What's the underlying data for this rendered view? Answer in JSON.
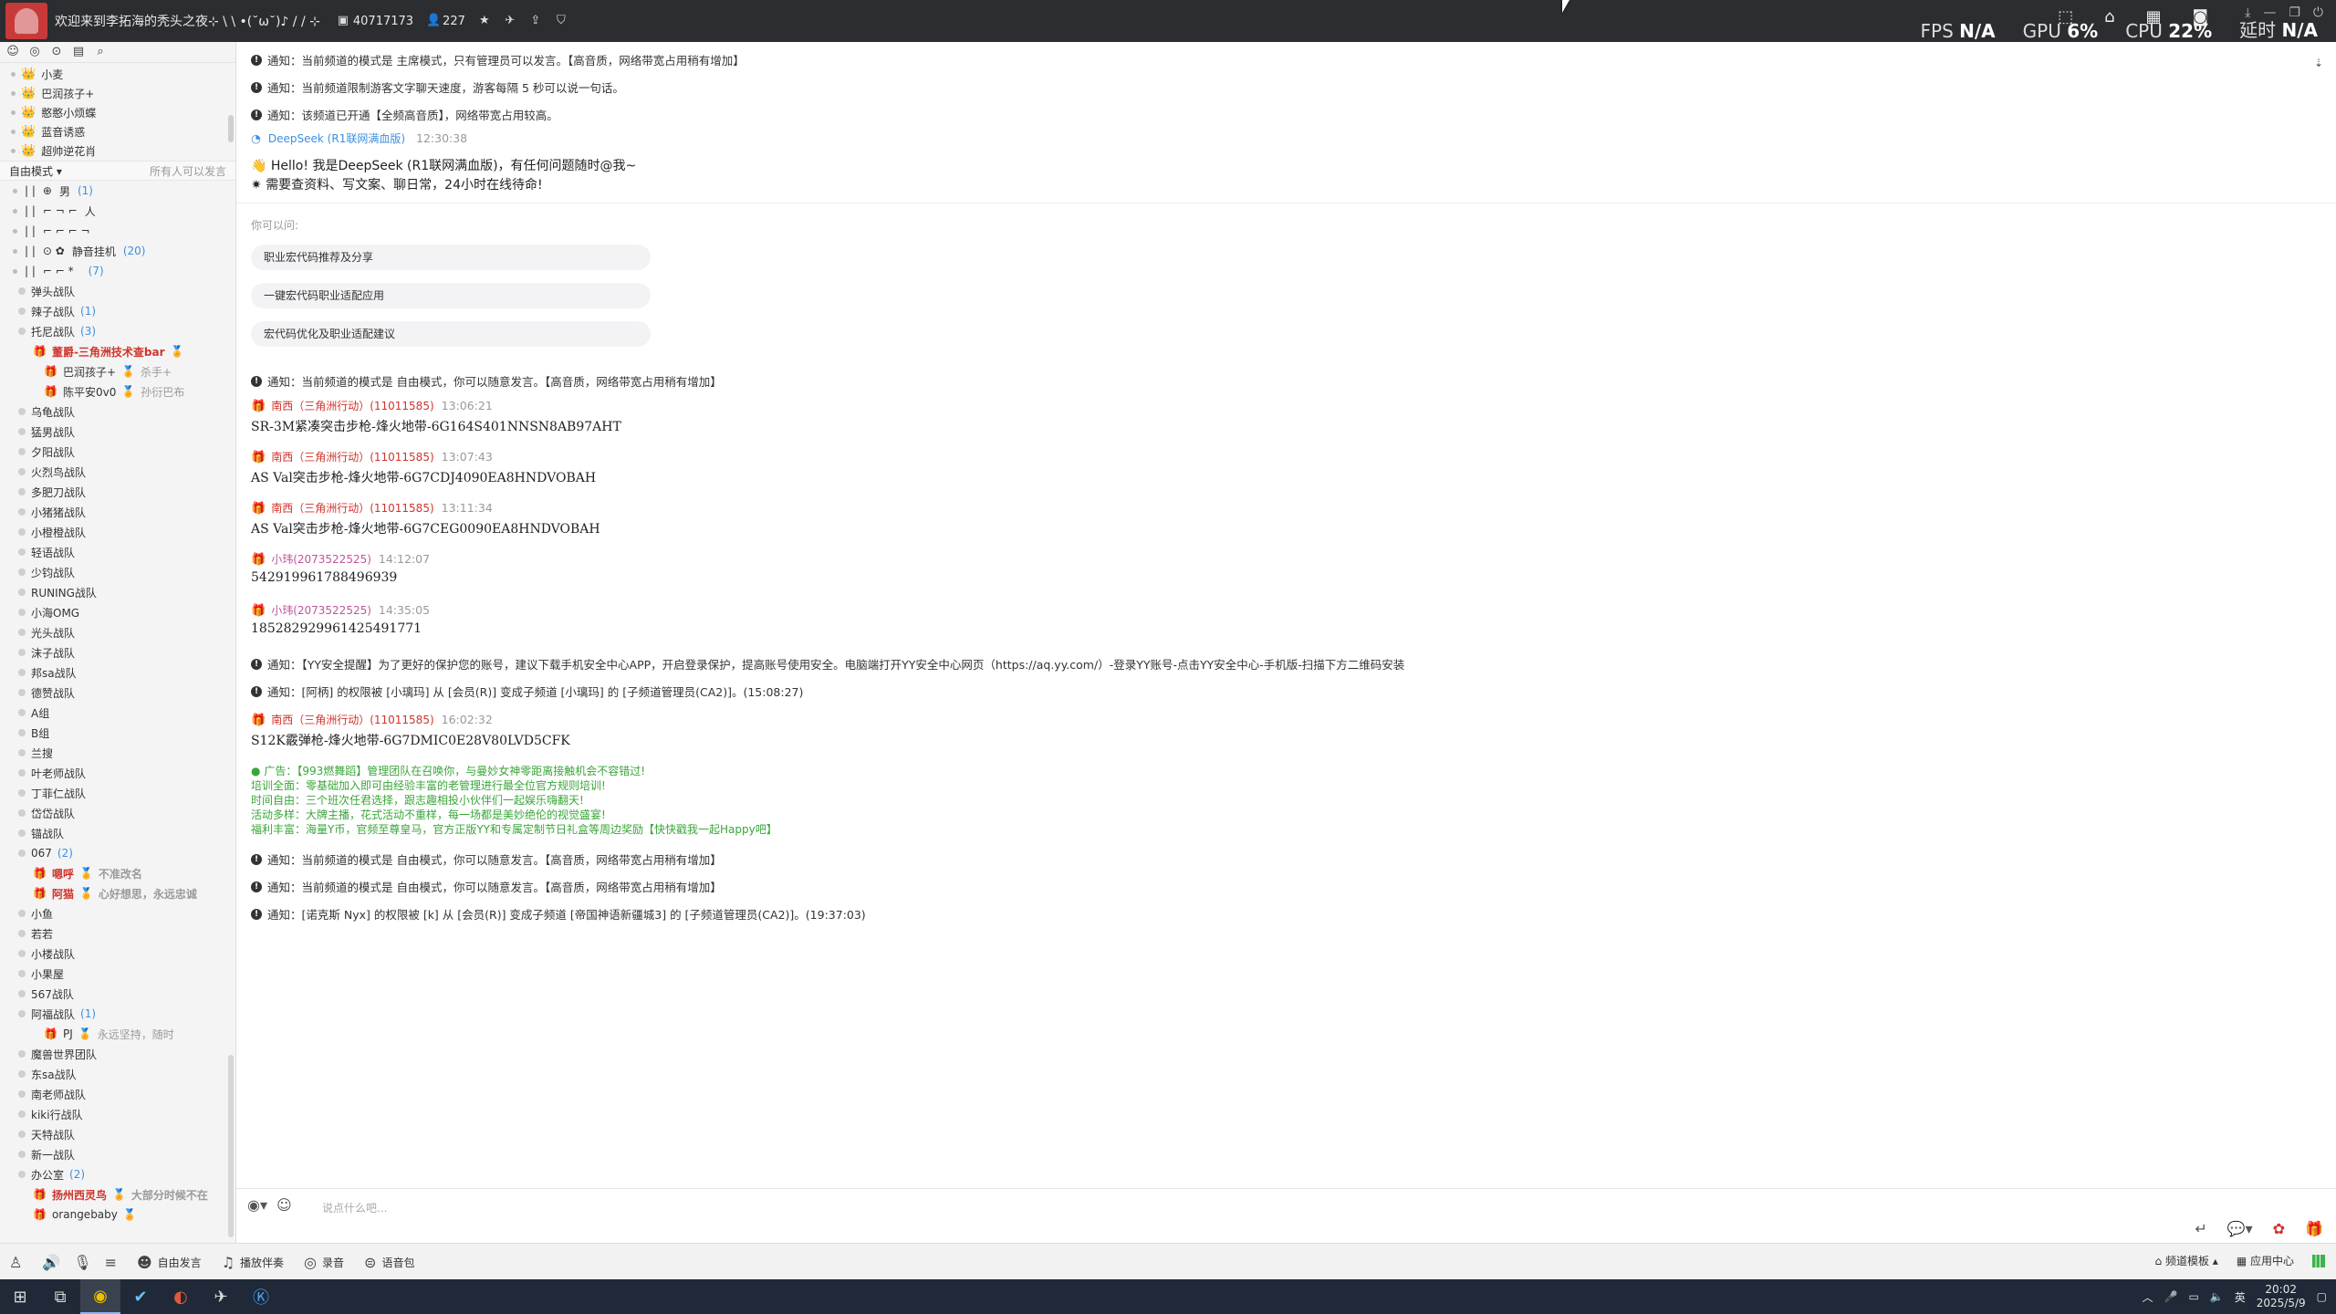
{
  "titlebar": {
    "title": "欢迎来到李拓海的秃头之夜⊹ \\ \\ •(˘ω˘)♪ / / ⊹",
    "channel_id": "40717173",
    "online_count": "227",
    "fps_label": "FPS",
    "fps_value": "N/A",
    "gpu_label": "GPU",
    "gpu_value": "6%",
    "cpu_label": "CPU",
    "cpu_value": "22%",
    "latency_label": "延时",
    "latency_value": "N/A"
  },
  "left": {
    "top_users": [
      "小麦",
      "巴润孩子+",
      "憨憨小烦蝶",
      "蓝音诱惑",
      "超帅逆花肖"
    ],
    "mode": "自由模式",
    "mode_note": "所有人可以发言",
    "symbol_rows": [
      {
        "a": "| |",
        "b": "⊕",
        "c": "男",
        "d": "(1)"
      },
      {
        "a": "| |",
        "b": "⌐ ¬ ⌐",
        "c": "人",
        "d": ""
      },
      {
        "a": "| |",
        "b": "⌐ ⌐ ⌐ ¬",
        "c": "",
        "d": ""
      },
      {
        "a": "| |",
        "b": "⊙ ✿",
        "c": "静音挂机",
        "d": "(20)"
      },
      {
        "a": "| |",
        "b": "⌐ ⌐ *",
        "c": "",
        "d": "(7)"
      }
    ],
    "channels_a": [
      {
        "name": "弹头战队",
        "count": ""
      },
      {
        "name": "辣子战队",
        "count": "(1)"
      },
      {
        "name": "托尼战队",
        "count": "(3)"
      }
    ],
    "tony_members": [
      {
        "name": "董爵-三角洲技术查bar",
        "note": ""
      },
      {
        "name": "巴润孩子+",
        "note": "杀手+"
      },
      {
        "name": "陈平安0v0",
        "note": "孙衍巴布"
      }
    ],
    "channels_b": [
      "乌龟战队",
      "猛男战队",
      "夕阳战队",
      "火烈鸟战队",
      "多肥刀战队",
      "小猪猪战队",
      "小橙橙战队",
      "轻语战队",
      "少钧战队",
      "RUNING战队",
      "小海OMG",
      "光头战队",
      "沫子战队",
      "邦sa战队",
      "德赞战队",
      "A组",
      "B组",
      "兰搜",
      "叶老师战队",
      "丁菲仁战队",
      "岱岱战队",
      "锚战队"
    ],
    "group067": {
      "name": "067",
      "count": "(2)"
    },
    "group067_members": [
      {
        "name": "嗯呼",
        "note": "不准改名"
      },
      {
        "name": "阿猫",
        "note": "心好想思，永远忠诚"
      }
    ],
    "channels_c": [
      "小鱼",
      "若若",
      "小楼战队",
      "小果屋",
      "567战队"
    ],
    "ahhu": {
      "name": "阿福战队",
      "count": "(1)"
    },
    "ahhu_member": {
      "name": "PJ",
      "note": "永远坚持，随时"
    },
    "channels_d": [
      "魔兽世界团队",
      "东sa战队",
      "南老师战队",
      "kiki行战队",
      "天特战队",
      "新一战队"
    ],
    "office": {
      "name": "办公室",
      "count": "(2)"
    },
    "office_members": [
      {
        "name": "扬州西灵鸟",
        "note": "大部分时候不在"
      },
      {
        "name": "orangebaby",
        "note": ""
      }
    ]
  },
  "chat": {
    "notices_top": [
      "通知：当前频道的模式是 主席模式，只有管理员可以发言。【高音质，网络带宽占用稍有增加】",
      "通知：当前频道限制游客文字聊天速度，游客每隔 5 秒可以说一句话。",
      "通知：该频道已开通【全频高音质】，网络带宽占用较高。"
    ],
    "bot": {
      "name": "DeepSeek (R1联网满血版)",
      "time": "12:30:38",
      "line1": "Hello! 我是DeepSeek (R1联网满血版)，有任何问题随时@我~",
      "line2": "需要查资料、写文案、聊日常，24小时在线待命!"
    },
    "suggest_label": "你可以问:",
    "suggestions": [
      "职业宏代码推荐及分享",
      "一键宏代码职业适配应用",
      "宏代码优化及职业适配建议"
    ],
    "notice_free1": "通知：当前频道的模式是 自由模式，你可以随意发言。【高音质，网络带宽占用稍有增加】",
    "messages1": [
      {
        "sender": "南西（三角洲行动）(11011585)",
        "time": "13:06:21",
        "text": "SR-3M紧凑突击步枪-烽火地带-6G164S401NNSN8AB97AHT"
      },
      {
        "sender": "南西（三角洲行动）(11011585)",
        "time": "13:07:43",
        "text": "AS Val突击步枪-烽火地带-6G7CDJ4090EA8HNDVOBAH"
      },
      {
        "sender": "南西（三角洲行动）(11011585)",
        "time": "13:11:34",
        "text": "AS Val突击步枪-烽火地带-6G7CEG0090EA8HNDVOBAH"
      },
      {
        "sender": "小玮(2073522525)",
        "time": "14:12:07",
        "text": "542919961788496939"
      },
      {
        "sender": "小玮(2073522525)",
        "time": "14:35:05",
        "text": "185282929961425491771"
      }
    ],
    "notice_security": "通知：【YY安全提醒】为了更好的保护您的账号，建议下载手机安全中心APP，开启登录保护，提高账号使用安全。电脑端打开YY安全中心网页（https://aq.yy.com/）-登录YY账号-点击YY安全中心-手机版-扫描下方二维码安装",
    "notice_perm1": "通知：[阿柄] 的权限被 [小璃玛] 从 [会员(R)] 变成子频道 [小璃玛] 的 [子频道管理员(CA2)]。(15:08:27)",
    "message_last": {
      "sender": "南西（三角洲行动）(11011585)",
      "time": "16:02:32",
      "text": "S12K霰弹枪-烽火地带-6G7DMIC0E28V80LVD5CFK"
    },
    "ad_lines": [
      "广告：【993燃舞蹈】管理团队在召唤你，与曼妙女神零距离接触机会不容错过!",
      "培训全面：零基础加入即可由经验丰富的老管理进行最全位官方规则培训!",
      "时间自由：三个班次任君选择，跟志趣相投小伙伴们一起娱乐嗨翻天!",
      "活动多样：大牌主播，花式活动不重样，每一场都是美妙绝伦的视觉盛宴!",
      "福利丰富：海量Y币，官频至尊皇马，官方正版YY和专属定制节日礼盒等周边奖励【快快戳我一起Happy吧】"
    ],
    "notice_free2": "通知：当前频道的模式是 自由模式，你可以随意发言。【高音质，网络带宽占用稍有增加】",
    "notice_free3": "通知：当前频道的模式是 自由模式，你可以随意发言。【高音质，网络带宽占用稍有增加】",
    "notice_perm2": "通知：[诺克斯 Nyx] 的权限被 [k] 从 [会员(R)] 变成子频道 [帝国神语新疆城3] 的 [子频道管理员(CA2)]。(19:37:03)"
  },
  "input": {
    "placeholder": "说点什么吧..."
  },
  "bottombar": {
    "free_speech": "自由发言",
    "play_music": "播放伴奏",
    "record": "录音",
    "voice_pack": "语音包",
    "channel_template": "频道模板",
    "app_center": "应用中心"
  },
  "taskbar": {
    "time": "20:02",
    "date": "2025/5/9",
    "ime": "英"
  }
}
